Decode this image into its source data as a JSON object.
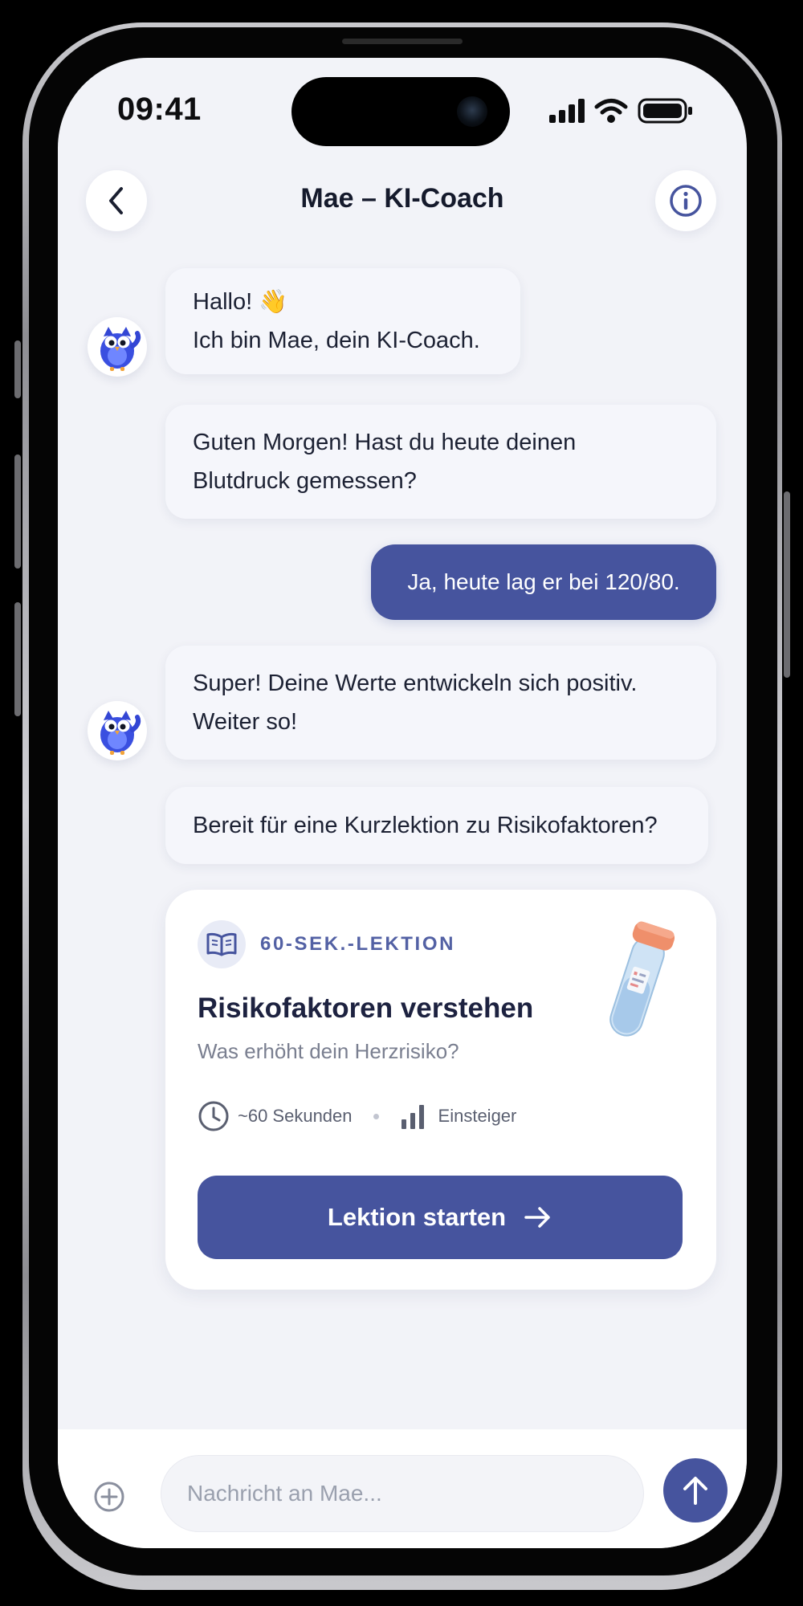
{
  "status_bar": {
    "time": "09:41"
  },
  "header": {
    "title": "Mae – KI-Coach"
  },
  "messages": {
    "bot_1_line1": "Hallo! 👋",
    "bot_1_line2": "Ich bin Mae, dein KI-Coach.",
    "bot_2_line1": "Guten Morgen! Hast du heute deinen",
    "bot_2_line2": "Blutdruck gemessen?",
    "user_1": "Ja, heute lag er bei 120/80.",
    "bot_3_line1": "Super! Deine Werte entwickeln sich positiv.",
    "bot_3_line2": "Weiter so!",
    "bot_4": "Bereit für eine Kurzlektion zu Risikofaktoren?"
  },
  "lesson_card": {
    "tag": "60-SEK.-LEKTION",
    "title": "Risikofaktoren verstehen",
    "subtitle": "Was erhöht dein Herzrisiko?",
    "duration": "~60 Sekunden",
    "level": "Einsteiger",
    "button_label": "Lektion starten"
  },
  "input": {
    "placeholder": "Nachricht an Mae..."
  },
  "icons": {
    "back": "chevron-left-icon",
    "info": "info-icon",
    "book": "book-open-icon",
    "clock": "clock-icon",
    "level": "bar-chart-icon",
    "arrow": "arrow-right-icon",
    "add": "plus-circle-icon",
    "send": "arrow-up-icon",
    "avatar": "owl-mascot",
    "illustration": "test-tube"
  },
  "colors": {
    "accent": "#46549e",
    "background": "#f2f3f8",
    "bubble": "#f5f6fb",
    "text": "#1c2133"
  }
}
